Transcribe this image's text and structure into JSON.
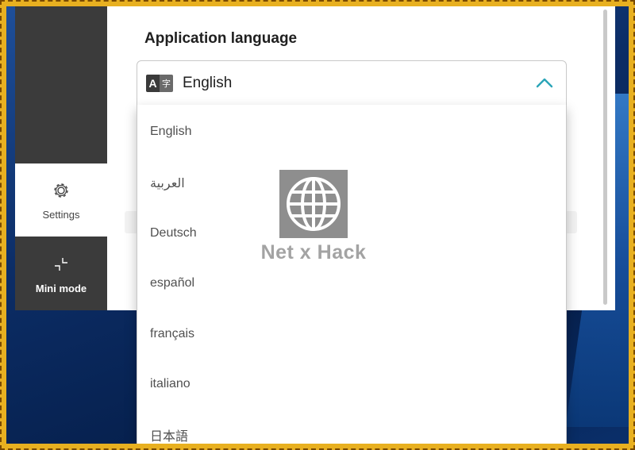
{
  "nav": {
    "settings_label": "Settings",
    "mini_mode_label": "Mini mode"
  },
  "language_section": {
    "title": "Application language",
    "selected": "English",
    "icon_glyphs": {
      "latin": "A",
      "cjk": "字"
    },
    "expanded": true,
    "options": [
      "English",
      "العربية",
      "Deutsch",
      "español",
      "français",
      "italiano",
      "日本語"
    ]
  },
  "watermark": {
    "text": "Net x Hack"
  },
  "colors": {
    "accent": "#2ba5b8",
    "nav_background": "#3b3b3b",
    "frame": "#e8b020"
  }
}
